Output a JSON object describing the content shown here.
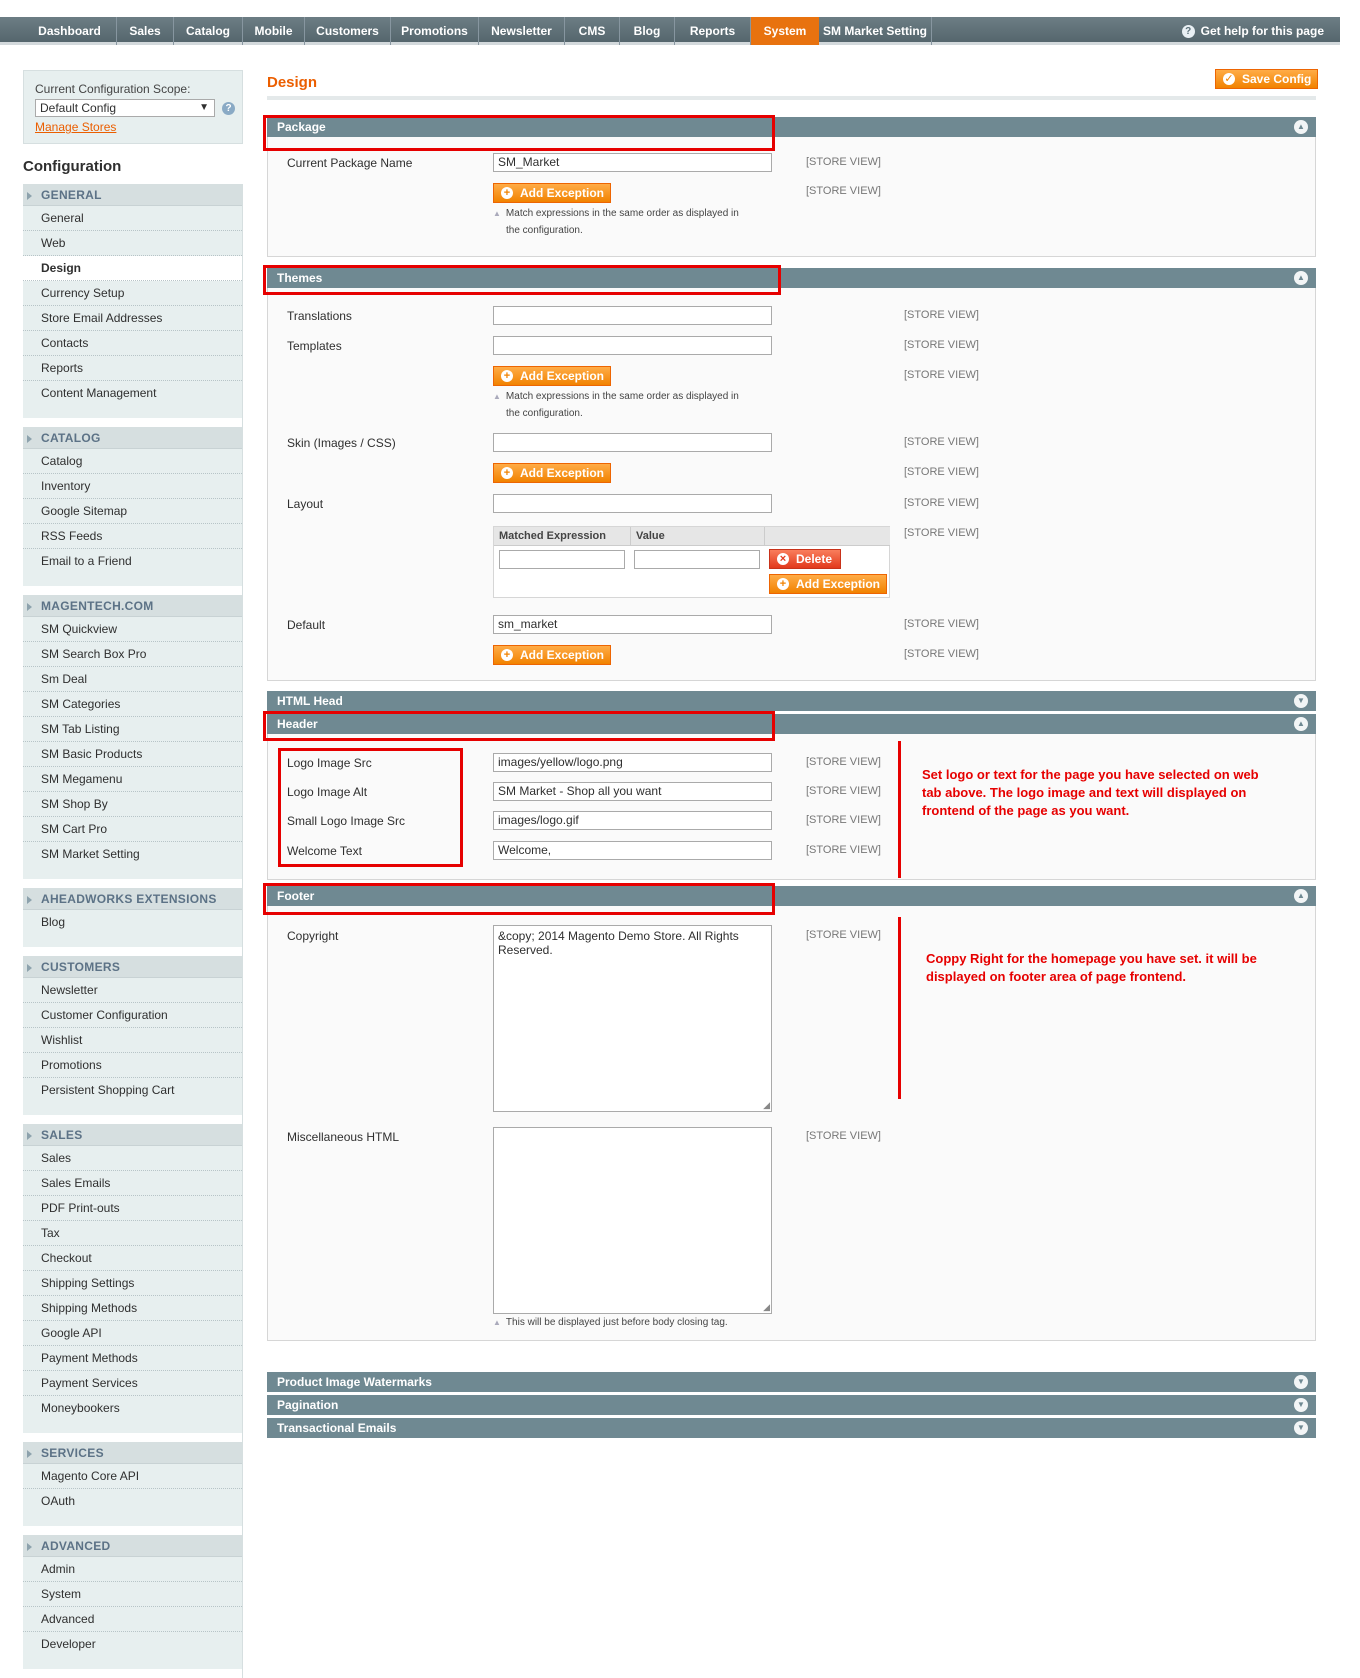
{
  "nav": {
    "items": [
      "Dashboard",
      "Sales",
      "Catalog",
      "Mobile",
      "Customers",
      "Promotions",
      "Newsletter",
      "CMS",
      "Blog",
      "Reports",
      "System",
      "SM Market Setting"
    ],
    "active": "System",
    "help": "Get help for this page"
  },
  "scope": {
    "label": "Current Configuration Scope:",
    "selected": "Default Config",
    "manage_link": "Manage Stores"
  },
  "sidebar": {
    "title": "Configuration",
    "groups": [
      {
        "name": "GENERAL",
        "items": [
          "General",
          "Web",
          "Design",
          "Currency Setup",
          "Store Email Addresses",
          "Contacts",
          "Reports",
          "Content Management"
        ]
      },
      {
        "name": "CATALOG",
        "items": [
          "Catalog",
          "Inventory",
          "Google Sitemap",
          "RSS Feeds",
          "Email to a Friend"
        ]
      },
      {
        "name": "MAGENTECH.COM",
        "items": [
          "SM Quickview",
          "SM Search Box Pro",
          "Sm Deal",
          "SM Categories",
          "SM Tab Listing",
          "SM Basic Products",
          "SM Megamenu",
          "SM Shop By",
          "SM Cart Pro",
          "SM Market Setting"
        ]
      },
      {
        "name": "AHEADWORKS EXTENSIONS",
        "items": [
          "Blog"
        ]
      },
      {
        "name": "CUSTOMERS",
        "items": [
          "Newsletter",
          "Customer Configuration",
          "Wishlist",
          "Promotions",
          "Persistent Shopping Cart"
        ]
      },
      {
        "name": "SALES",
        "items": [
          "Sales",
          "Sales Emails",
          "PDF Print-outs",
          "Tax",
          "Checkout",
          "Shipping Settings",
          "Shipping Methods",
          "Google API",
          "Payment Methods",
          "Payment Services",
          "Moneybookers"
        ]
      },
      {
        "name": "SERVICES",
        "items": [
          "Magento Core API",
          "OAuth"
        ]
      },
      {
        "name": "ADVANCED",
        "items": [
          "Admin",
          "System",
          "Advanced",
          "Developer"
        ]
      }
    ],
    "active_item": "Design"
  },
  "page": {
    "title": "Design",
    "save_label": "Save Config"
  },
  "common": {
    "store_view": "[STORE VIEW]",
    "add_exception": "Add Exception",
    "delete": "Delete",
    "match_note_1": "Match expressions in the same order as displayed in",
    "match_note_2": "the configuration."
  },
  "package": {
    "title": "Package",
    "current_label": "Current Package Name",
    "current_value": "SM_Market"
  },
  "themes": {
    "title": "Themes",
    "translations_label": "Translations",
    "translations_value": "",
    "templates_label": "Templates",
    "templates_value": "",
    "skin_label": "Skin (Images / CSS)",
    "skin_value": "",
    "layout_label": "Layout",
    "layout_value": "",
    "col_matched": "Matched Expression",
    "col_value": "Value",
    "default_label": "Default",
    "default_value": "sm_market"
  },
  "html_head": {
    "title": "HTML Head"
  },
  "header": {
    "title": "Header",
    "logo_src_label": "Logo Image Src",
    "logo_src_value": "images/yellow/logo.png",
    "logo_alt_label": "Logo Image Alt",
    "logo_alt_value": "SM Market - Shop all you want",
    "small_logo_label": "Small Logo Image Src",
    "small_logo_value": "images/logo.gif",
    "welcome_label": "Welcome Text",
    "welcome_value": "Welcome,",
    "annotation": [
      "Set logo or text for the page you have selected on web",
      "tab above.  The logo image and text will displayed on",
      "frontend of the page as you want."
    ]
  },
  "footer": {
    "title": "Footer",
    "copyright_label": "Copyright",
    "copyright_value_1": "&copy; 2014 Magento Demo Store. All Rights",
    "copyright_value_2": "Reserved.",
    "misc_label": "Miscellaneous HTML",
    "misc_value": "",
    "misc_note": "This will be displayed just before body closing tag.",
    "annotation": [
      "Coppy Right for the homepage you have set. it will be",
      "displayed on footer area of page frontend."
    ]
  },
  "collapsed": {
    "watermarks": "Product Image Watermarks",
    "pagination": "Pagination",
    "emails": "Transactional Emails"
  },
  "colors": {
    "accent": "#eb5e00",
    "active_tab": "#e8720f",
    "section_header": "#6f8992",
    "annotation_red": "#e60000"
  }
}
